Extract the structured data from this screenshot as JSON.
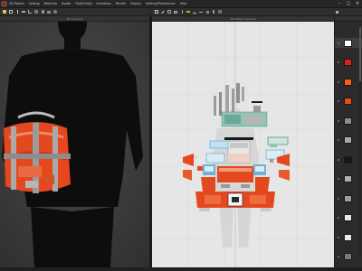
{
  "menubar": {
    "items": [
      "2D Pattern",
      "Sewing",
      "Materials",
      "Avatar",
      "Fold/Unfold",
      "Animation",
      "Render",
      "Display",
      "Settings/Preferences",
      "Help"
    ]
  },
  "panes": {
    "left_title": "3D Garment",
    "right_title": "2D Pattern Window"
  },
  "icons": {
    "logo": "clo-logo-icon",
    "window": [
      "minimize-icon",
      "maximize-icon",
      "close-icon"
    ]
  },
  "colors": {
    "ui_dark": "#2a2a2a",
    "pattern_bg": "#e6e6e6",
    "fabric_orange": "#e4481f",
    "fabric_grey": "#9a9a9a",
    "fabric_teal": "#8fc4b6",
    "fabric_blue": "#6fb0d8",
    "avatar": "#0d0d0d"
  },
  "swatches": [
    {
      "color": "#ffffff",
      "selected": true
    },
    {
      "color": "#e11d1d"
    },
    {
      "color": "#ff5a14"
    },
    {
      "color": "#e84a1a"
    },
    {
      "color": "#8c8c8c"
    },
    {
      "color": "#a8a8a8"
    },
    {
      "color": "#151515"
    },
    {
      "color": "#b0b0b0"
    },
    {
      "color": "#9e9e9e"
    },
    {
      "color": "#e8e8e8"
    },
    {
      "color": "#f2e6e6"
    },
    {
      "color": "#7a7a7a"
    }
  ]
}
